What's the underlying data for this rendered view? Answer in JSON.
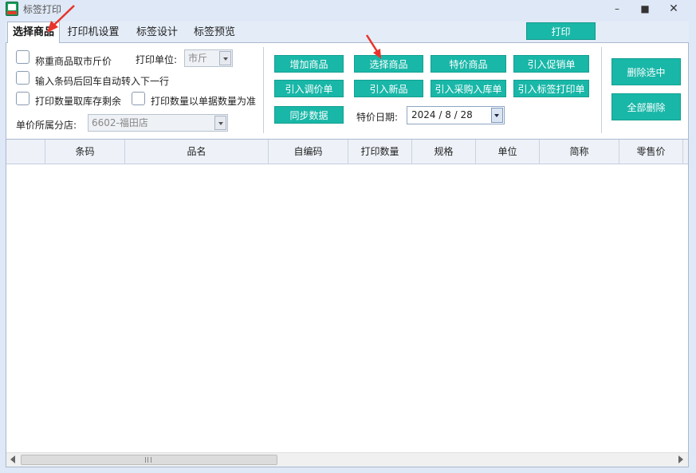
{
  "window": {
    "title": "标签打印",
    "controls": [
      "minimize",
      "maximize",
      "close"
    ]
  },
  "tabs": [
    {
      "label": "选择商品",
      "active": true
    },
    {
      "label": "打印机设置",
      "active": false
    },
    {
      "label": "标签设计",
      "active": false
    },
    {
      "label": "标签预览",
      "active": false
    }
  ],
  "print_button_label": "打印",
  "options": {
    "checkbox_weighted": "称重商品取市斤价",
    "checkbox_barcode_enter": "输入条码后回车自动转入下一行",
    "checkbox_stock_remaining": "打印数量取库存剩余",
    "checkbox_doc_quantity": "打印数量以单据数量为准",
    "print_unit_label": "打印单位:",
    "print_unit_value": "市斤",
    "branch_label": "单价所属分店:",
    "branch_value": "6602-福田店"
  },
  "actions": {
    "add_goods": "增加商品",
    "select_goods": "选择商品",
    "special_goods": "特价商品",
    "import_promo": "引入促销单",
    "import_price_adjust": "引入调价单",
    "import_new": "引入新品",
    "import_purchase": "引入采购入库单",
    "import_label_print": "引入标签打印单",
    "sync_data": "同步数据",
    "special_date_label": "特价日期:",
    "special_date_value": "2024 / 8 / 28",
    "delete_selected": "删除选中",
    "delete_all": "全部删除"
  },
  "table": {
    "columns": [
      "条码",
      "品名",
      "自编码",
      "打印数量",
      "规格",
      "单位",
      "简称",
      "零售价"
    ],
    "rows": []
  },
  "colors": {
    "accent": "#19b7a8",
    "window_bg": "#dfe8f6",
    "annotation": "#e8332a"
  }
}
